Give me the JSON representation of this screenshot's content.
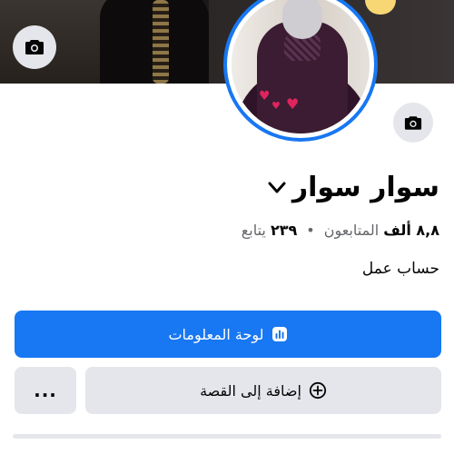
{
  "profile": {
    "name": "سوار سوار",
    "followers_count": "٨,٨ ألف",
    "followers_label": "المتابعون",
    "following_count": "٢٣٩",
    "following_label": "يتابع",
    "separator": "•",
    "bio": "حساب عمل"
  },
  "actions": {
    "dashboard_label": "لوحة المعلومات",
    "add_story_label": "إضافة إلى القصة",
    "more_label": "..."
  },
  "icons": {
    "cover_camera": "camera-icon",
    "profile_camera": "camera-icon",
    "name_dropdown": "chevron-down-icon",
    "dashboard": "bar-chart-icon",
    "add_story": "plus-circle-icon"
  },
  "colors": {
    "accent": "#1877f2",
    "secondary_button": "#e4e6eb",
    "text_primary": "#050505",
    "text_secondary": "#65676b"
  }
}
